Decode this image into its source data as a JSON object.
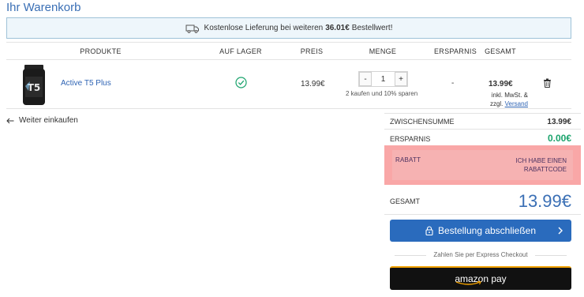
{
  "page": {
    "title": "Ihr Warenkorb"
  },
  "shipping": {
    "text_before": "Kostenlose Lieferung bei weiteren",
    "amount": "36.01€",
    "text_after": "Bestellwert!",
    "icon": "truck-icon"
  },
  "table": {
    "headers": {
      "products": "PRODUKTE",
      "in_stock": "AUF LAGER",
      "price": "PREIS",
      "quantity": "MENGE",
      "savings": "ERSPARNIS",
      "total": "GESAMT"
    }
  },
  "item": {
    "name": "Active T5 Plus",
    "stock_icon": "check-circle-icon",
    "price": "13.99€",
    "quantity": "1",
    "qty_minus": "-",
    "qty_plus": "+",
    "qty_hint": "2 kaufen und 10% sparen",
    "savings": "-",
    "total": "13.99€",
    "tax_note": "inkl. MwSt. &",
    "tax_note2": "zzgl.",
    "shipping_link": "Versand",
    "remove_icon": "trash-icon"
  },
  "continue_shopping": "Weiter einkaufen",
  "summary": {
    "subtotal_label": "ZWISCHENSUMME",
    "subtotal_value": "13.99€",
    "savings_label": "ERSPARNIS",
    "savings_value": "0.00€",
    "discount_label": "RABATT",
    "discount_code_link": "ICH HABE EINEN RABATTCODE",
    "total_label": "GESAMT",
    "total_value": "13.99€"
  },
  "checkout": {
    "order_button": "Bestellung abschließen",
    "express_label": "Zahlen Sie per Express Checkout",
    "amazon_pay": "amazon pay"
  },
  "colors": {
    "accent": "#3a6fb5",
    "savings_green": "#1aa36c",
    "banner_bg": "#eef6fb",
    "discount_highlight": "#f9a7a7",
    "amazon_bg": "#111111"
  }
}
